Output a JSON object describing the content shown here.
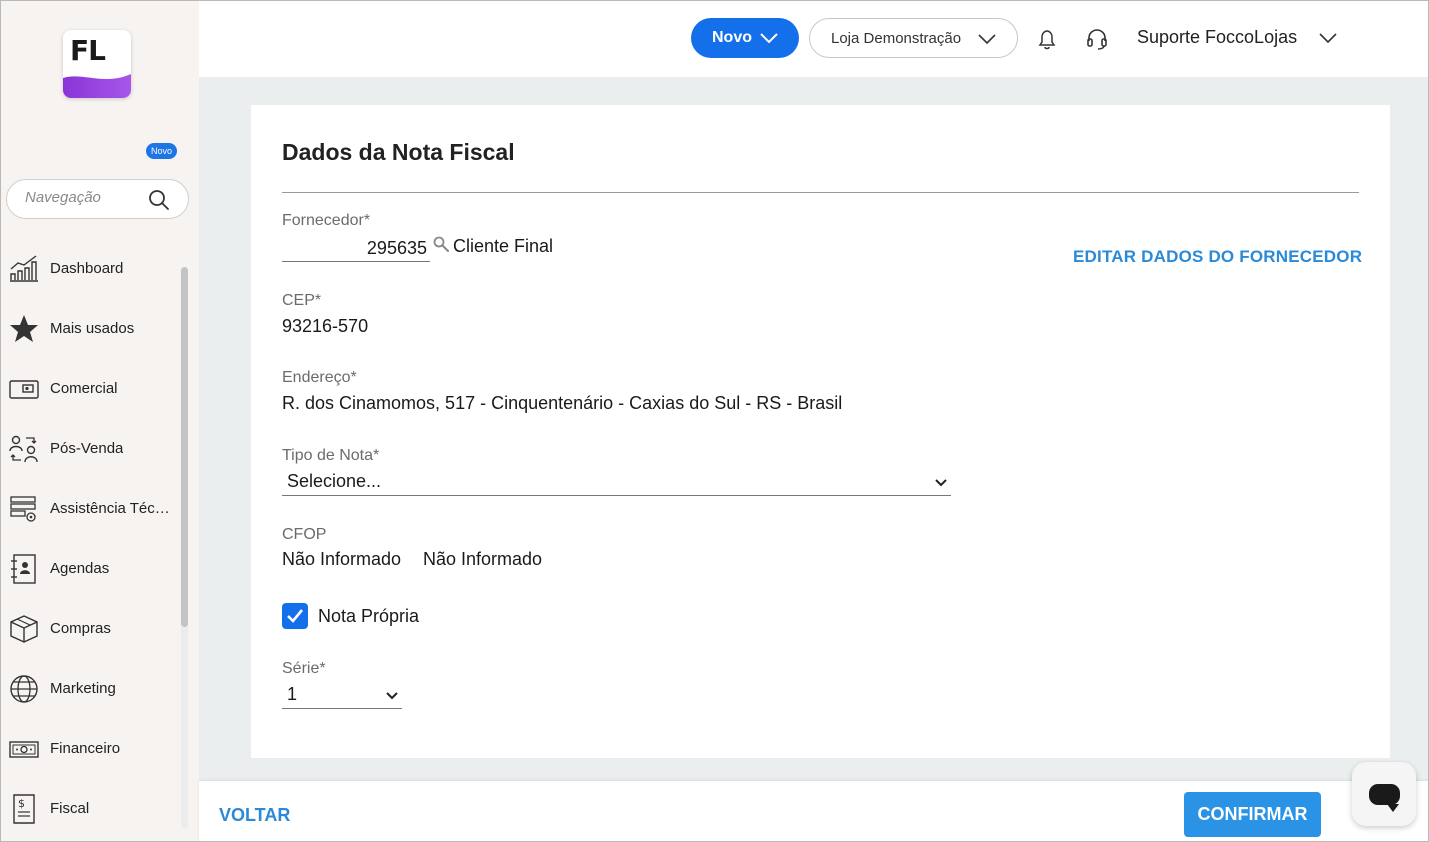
{
  "sidebar": {
    "logo_text": "FL",
    "search_placeholder": "Navegação",
    "items": [
      {
        "label": "Dashboard",
        "icon": "chart-icon"
      },
      {
        "label": "Mais usados",
        "icon": "star-icon"
      },
      {
        "label": "Comercial",
        "icon": "wallet-icon",
        "badge": "Novo"
      },
      {
        "label": "Pós-Venda",
        "icon": "people-exchange-icon"
      },
      {
        "label": "Assistência Técnica",
        "icon": "gear-server-icon"
      },
      {
        "label": "Agendas",
        "icon": "contact-book-icon"
      },
      {
        "label": "Compras",
        "icon": "box-icon"
      },
      {
        "label": "Marketing",
        "icon": "globe-icon"
      },
      {
        "label": "Financeiro",
        "icon": "cash-icon"
      },
      {
        "label": "Fiscal",
        "icon": "receipt-icon"
      }
    ]
  },
  "topbar": {
    "new_button": "Novo",
    "store": "Loja Demonstração",
    "user": "Suporte FoccoLojas"
  },
  "form": {
    "title": "Dados da Nota Fiscal",
    "supplier": {
      "label": "Fornecedor*",
      "code": "295635",
      "name": "Cliente Final",
      "edit_link": "EDITAR DADOS DO FORNECEDOR"
    },
    "cep": {
      "label": "CEP*",
      "value": "93216-570"
    },
    "address": {
      "label": "Endereço*",
      "value": "R. dos Cinamomos, 517 - Cinquentenário - Caxias do Sul - RS - Brasil"
    },
    "note_type": {
      "label": "Tipo de Nota*",
      "value": "Selecione..."
    },
    "cfop": {
      "label": "CFOP",
      "code": "Não Informado",
      "description": "Não Informado"
    },
    "own_note": {
      "label": "Nota Própria",
      "checked": true
    },
    "series": {
      "label": "Série*",
      "value": "1"
    }
  },
  "footer": {
    "back": "VOLTAR",
    "confirm": "CONFIRMAR"
  },
  "colors": {
    "primary": "#1470ea",
    "link": "#2a8ad8",
    "confirm": "#2a93e6",
    "sidebar_bg": "#f7f3f1",
    "page_bg": "#eaeeee"
  }
}
